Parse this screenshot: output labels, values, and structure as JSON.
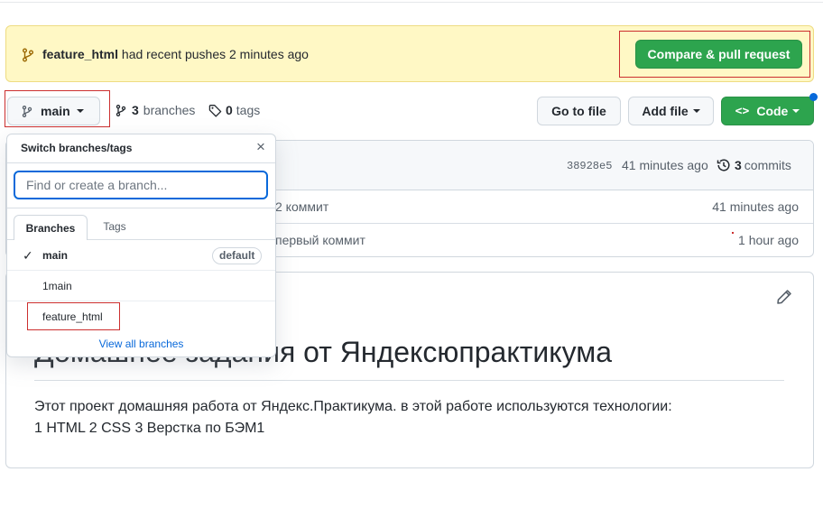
{
  "banner": {
    "branch": "feature_html",
    "message": "had recent pushes 2 minutes ago",
    "compare_button": "Compare & pull request"
  },
  "repo_bar": {
    "current_branch": "main",
    "branches_count": "3",
    "branches_label": "branches",
    "tags_count": "0",
    "tags_label": "tags",
    "goto_file": "Go to file",
    "add_file": "Add file",
    "code": "Code"
  },
  "commit_table": {
    "sha": "38928e5",
    "time": "41 minutes ago",
    "commits_count": "3",
    "commits_label": "commits",
    "rows": [
      {
        "message": "2 коммит",
        "time": "41 minutes ago"
      },
      {
        "message": "первый коммит",
        "time": "1 hour ago"
      }
    ]
  },
  "readme": {
    "title": "Домашнее задания от Яндексюпрактикума",
    "line1": "Этот проект домашняя работа от Яндекс.Практикума. в этой работе используются технологии:",
    "line2": "1 HTML 2 CSS 3 Верстка по БЭМ1"
  },
  "dropdown": {
    "title": "Switch branches/tags",
    "search_placeholder": "Find or create a branch...",
    "tabs": [
      "Branches",
      "Tags"
    ],
    "branches": [
      {
        "name": "main",
        "badge": "default"
      },
      {
        "name": "1main"
      },
      {
        "name": "feature_html"
      }
    ],
    "view_all": "View all branches"
  },
  "colors": {
    "green": "#2da44e",
    "blue": "#0969da",
    "banner_bg": "#fff8c5",
    "highlight_red": "#cc2f2f"
  }
}
